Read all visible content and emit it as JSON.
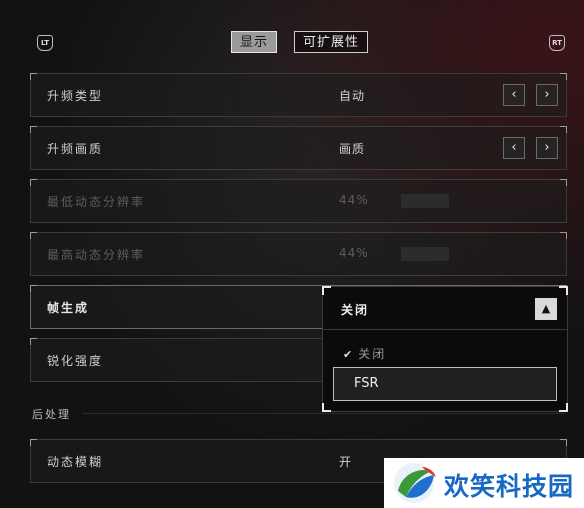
{
  "header": {
    "left_trigger": "LT",
    "right_trigger": "RT",
    "tabs": [
      {
        "label": "显示",
        "active": true
      },
      {
        "label": "可扩展性",
        "active": false
      }
    ]
  },
  "settings": [
    {
      "label": "升频类型",
      "value": "自动",
      "enabled": true,
      "control": "arrows"
    },
    {
      "label": "升频画质",
      "value": "画质",
      "enabled": true,
      "control": "arrows"
    },
    {
      "label": "最低动态分辨率",
      "value": "44%",
      "enabled": false,
      "control": "slider"
    },
    {
      "label": "最高动态分辨率",
      "value": "44%",
      "enabled": false,
      "control": "slider"
    },
    {
      "label": "帧生成",
      "value": "关闭",
      "enabled": true,
      "control": "dropdown"
    },
    {
      "label": "锐化强度",
      "value": "",
      "enabled": true,
      "control": "slider"
    }
  ],
  "section": {
    "title": "后处理"
  },
  "post_settings": [
    {
      "label": "动态模糊",
      "value": "开",
      "enabled": true
    }
  ],
  "dropdown": {
    "selected": "关闭",
    "options": [
      {
        "label": "关闭",
        "checked": true
      },
      {
        "label": "FSR",
        "highlighted": true
      }
    ]
  },
  "watermark": {
    "text": "欢笑科技园"
  },
  "icons": {
    "prev": "chevron-left-icon",
    "next": "chevron-right-icon",
    "caret": "chevron-up-icon",
    "check": "check-icon"
  },
  "colors": {
    "accent_bg": "#9a9a9a",
    "background": "#121212",
    "watermark_blue": "#1769c4"
  }
}
